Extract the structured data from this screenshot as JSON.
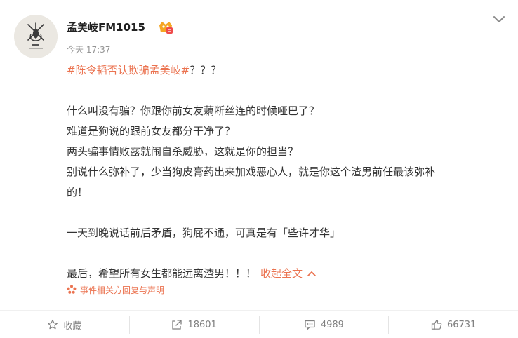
{
  "post": {
    "username": "孟美岐FM1015",
    "time": "今天 17:37",
    "hashtag": "#陈令韬否认欺骗孟美岐#",
    "hashtag_tail": "？？？",
    "lines": [
      "什么叫没有骗？你跟你前女友藕断丝连的时候哑巴了？",
      "难道是狗说的跟前女友都分干净了？",
      "两头骗事情败露就闹自杀威胁，这就是你的担当？",
      "别说什么弥补了，少当狗皮膏药出来加戏恶心人，就是你这个渣男前任最该弥补",
      "的！"
    ],
    "line_after_gap": "一天到晚说话前后矛盾，狗屁不通，可真是有「些许才华」",
    "last_line": "最后，希望所有女生都能远离渣男！！！",
    "collapse_label": "收起全文",
    "event_label": "事件相关方回复与声明"
  },
  "actions": {
    "favorite": "收藏",
    "repost": "18601",
    "comment": "4989",
    "like": "66731"
  },
  "icons": {
    "avatar": "emblem-avatar-icon",
    "badge": "vip-badge-icon",
    "menu": "chevron-down-icon",
    "event": "flower-icon"
  },
  "colors": {
    "accent": "#eb7350",
    "text": "#333333",
    "meta": "#939393",
    "action": "#808080"
  }
}
